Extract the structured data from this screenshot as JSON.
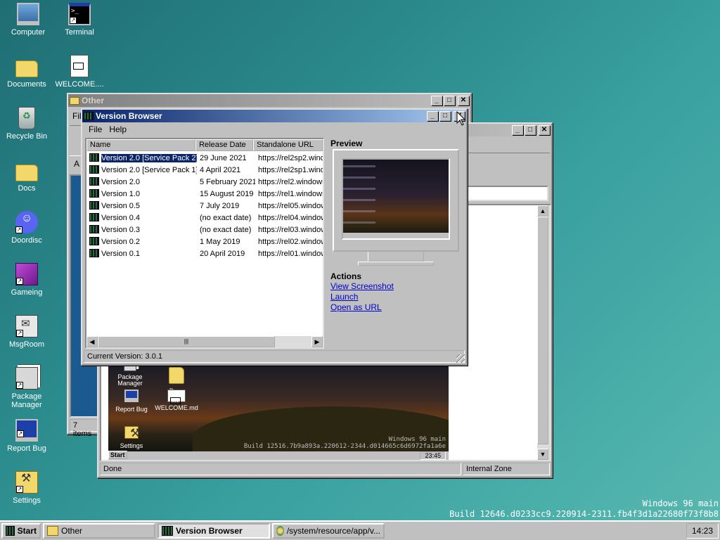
{
  "desktop": {
    "icons": [
      {
        "label": "Computer"
      },
      {
        "label": "Terminal"
      },
      {
        "label": "Documents"
      },
      {
        "label": "WELCOME...."
      },
      {
        "label": "Recycle Bin"
      },
      {
        "label": "Docs"
      },
      {
        "label": "Doordisc"
      },
      {
        "label": "Gameing"
      },
      {
        "label": "MsgRoom"
      },
      {
        "label": "Package Manager"
      },
      {
        "label": "Report Bug"
      },
      {
        "label": "Settings"
      }
    ],
    "watermark": {
      "line1": "Windows 96 main",
      "line2": "Build 12646.d0233cc9.220914-2311.fb4f3d1a22680f73f8b8"
    }
  },
  "other_window": {
    "title": "Other",
    "menu_partial": "Fil",
    "address_partial": "A",
    "status": "7 items"
  },
  "browser_window": {
    "status_left": "Done",
    "status_right": "Internal Zone",
    "screenshot": {
      "icons": [
        "Package Manager",
        "Docs",
        "Report Bug",
        "WELCOME.md",
        "Settings"
      ],
      "start": "Start",
      "clock": "23:45",
      "wm1": "Windows 96 main",
      "wm2": "Build 12516.7b9a893a.220612-2344.d014665c6d6972fa1a6e"
    }
  },
  "version_browser": {
    "title": "Version Browser",
    "menu": {
      "file": "File",
      "help": "Help"
    },
    "columns": {
      "name": "Name",
      "date": "Release Date",
      "url": "Standalone URL"
    },
    "rows": [
      {
        "name": "Version 2.0 [Service Pack 2]",
        "date": "29 June 2021",
        "url": "https://rel2sp2.windows96.net"
      },
      {
        "name": "Version 2.0 [Service Pack 1]",
        "date": "4 April 2021",
        "url": "https://rel2sp1.windows96.net"
      },
      {
        "name": "Version 2.0",
        "date": "5 February 2021",
        "url": "https://rel2.windows96.net"
      },
      {
        "name": "Version 1.0",
        "date": "15 August 2019",
        "url": "https://rel1.windows96.net"
      },
      {
        "name": "Version 0.5",
        "date": "7 July 2019",
        "url": "https://rel05.windows96.net"
      },
      {
        "name": "Version 0.4",
        "date": "(no exact date)",
        "url": "https://rel04.windows96.net"
      },
      {
        "name": "Version 0.3",
        "date": "(no exact date)",
        "url": "https://rel03.windows96.net"
      },
      {
        "name": "Version 0.2",
        "date": "1 May 2019",
        "url": "https://rel02.windows96.net"
      },
      {
        "name": "Version 0.1",
        "date": "20 April 2019",
        "url": "https://rel01.windows96.net"
      }
    ],
    "preview_heading": "Preview",
    "actions_heading": "Actions",
    "actions": {
      "screenshot": "View Screenshot",
      "launch": "Launch",
      "url": "Open as URL"
    },
    "status": "Current Version: 3.0.1"
  },
  "taskbar": {
    "start": "Start",
    "tasks": {
      "other": "Other",
      "vb": "Version Browser",
      "path": "/system/resource/app/v..."
    },
    "clock": "14:23"
  }
}
